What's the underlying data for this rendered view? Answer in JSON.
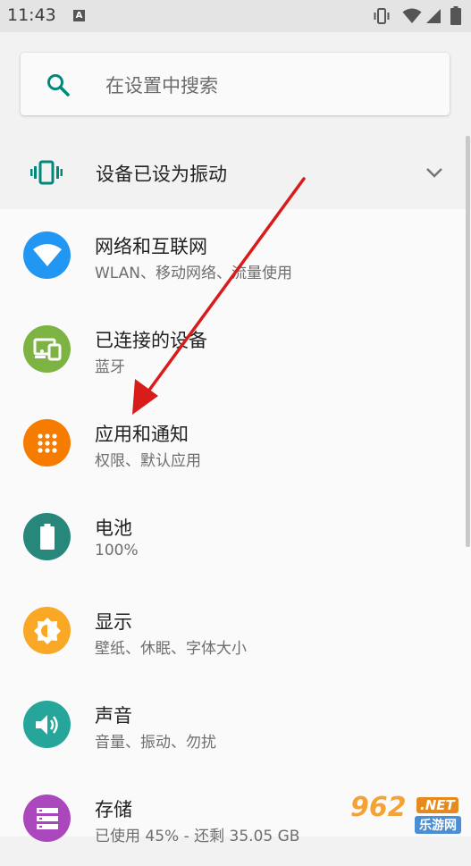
{
  "status_bar": {
    "time": "11:43",
    "notification_icon": "A",
    "icons": [
      "vibrate-icon",
      "wifi-icon",
      "cell-signal-icon",
      "battery-icon"
    ]
  },
  "search": {
    "placeholder": "在设置中搜索",
    "icon": "search-icon",
    "accent_color": "#00897b"
  },
  "condition": {
    "text": "设备已设为振动",
    "icon": "vibrate-icon",
    "accent_color": "#00897b"
  },
  "settings": [
    {
      "title": "网络和互联网",
      "subtitle": "WLAN、移动网络、流量使用",
      "icon": "wifi-icon",
      "color": "#2196f3"
    },
    {
      "title": "已连接的设备",
      "subtitle": "蓝牙",
      "icon": "devices-icon",
      "color": "#7cb342"
    },
    {
      "title": "应用和通知",
      "subtitle": "权限、默认应用",
      "icon": "apps-icon",
      "color": "#f57c00"
    },
    {
      "title": "电池",
      "subtitle": "100%",
      "icon": "battery-icon",
      "color": "#26877a"
    },
    {
      "title": "显示",
      "subtitle": "壁纸、休眠、字体大小",
      "icon": "brightness-icon",
      "color": "#f9a825"
    },
    {
      "title": "声音",
      "subtitle": "音量、振动、勿扰",
      "icon": "volume-icon",
      "color": "#26a69a"
    },
    {
      "title": "存储",
      "subtitle": "已使用 45% - 还剩 35.05 GB",
      "icon": "storage-icon",
      "color": "#ab47bc"
    }
  ],
  "annotation": {
    "arrow_color": "#d81b1b"
  },
  "watermark": {
    "number": "962",
    "suffix": ".NET",
    "caption": "乐游网"
  }
}
